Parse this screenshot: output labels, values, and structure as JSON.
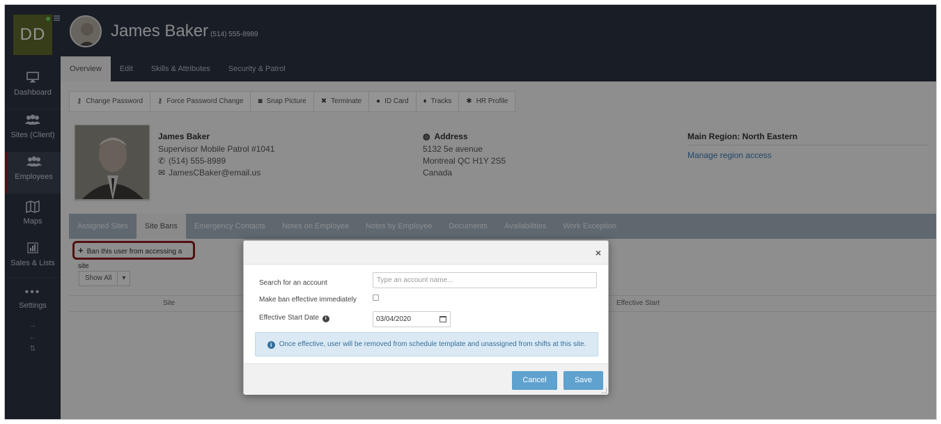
{
  "sidebar": {
    "logo_text": "DD",
    "items": [
      {
        "label": "Dashboard",
        "icon": "monitor-icon"
      },
      {
        "label": "Sites (Client)",
        "icon": "users-icon"
      },
      {
        "label": "Employees",
        "icon": "employees-icon"
      },
      {
        "label": "Maps",
        "icon": "map-icon"
      },
      {
        "label": "Sales & Lists",
        "icon": "bar-chart-icon"
      },
      {
        "label": "Settings",
        "icon": "dots-icon"
      }
    ],
    "arrows": [
      "→",
      "←",
      "⇅"
    ]
  },
  "header": {
    "name": "James Baker",
    "phone": "(514) 555-8989",
    "tabs": [
      "Overview",
      "Edit",
      "Skills & Attributes",
      "Security & Patrol"
    ]
  },
  "toolbar": [
    {
      "label": "Change Password",
      "icon": "key-icon"
    },
    {
      "label": "Force Password Change",
      "icon": "key-icon"
    },
    {
      "label": "Snap Picture",
      "icon": "camera-icon"
    },
    {
      "label": "Terminate",
      "icon": "x-icon"
    },
    {
      "label": "ID Card",
      "icon": "id-icon"
    },
    {
      "label": "Tracks",
      "icon": "pin-icon"
    },
    {
      "label": "HR Profile",
      "icon": "gear-icon"
    }
  ],
  "employee": {
    "name": "James Baker",
    "title": "Supervisor Mobile Patrol #1041",
    "phone": "(514) 555-8989",
    "email": "JamesCBaker@email.us"
  },
  "address": {
    "label": "Address",
    "line1": "5132 5e avenue",
    "line2": "Montreal QC H1Y 2S5",
    "line3": "Canada"
  },
  "region": {
    "label": "Main Region: North Eastern",
    "link": "Manage region access"
  },
  "subtabs": [
    "Assigned Sites",
    "Site Bans",
    "Emergency Contacts",
    "Notes on Employee",
    "Notes by Employee",
    "Documents",
    "Availabilities",
    "Work Exception"
  ],
  "site_bans": {
    "ban_link": "Ban this user from accessing a site",
    "show_all": "Show All",
    "col_site": "Site",
    "col_start": "Effective Start"
  },
  "modal": {
    "search_label": "Search for an account",
    "search_placeholder": "Type an account name...",
    "immediate_label": "Make ban effective immediately",
    "start_label": "Effective Start Date",
    "start_value": "03/04/2020",
    "info_text": "Once effective, user will be removed from schedule template and unassigned from shifts at this site.",
    "cancel": "Cancel",
    "save": "Save",
    "close": "×"
  }
}
